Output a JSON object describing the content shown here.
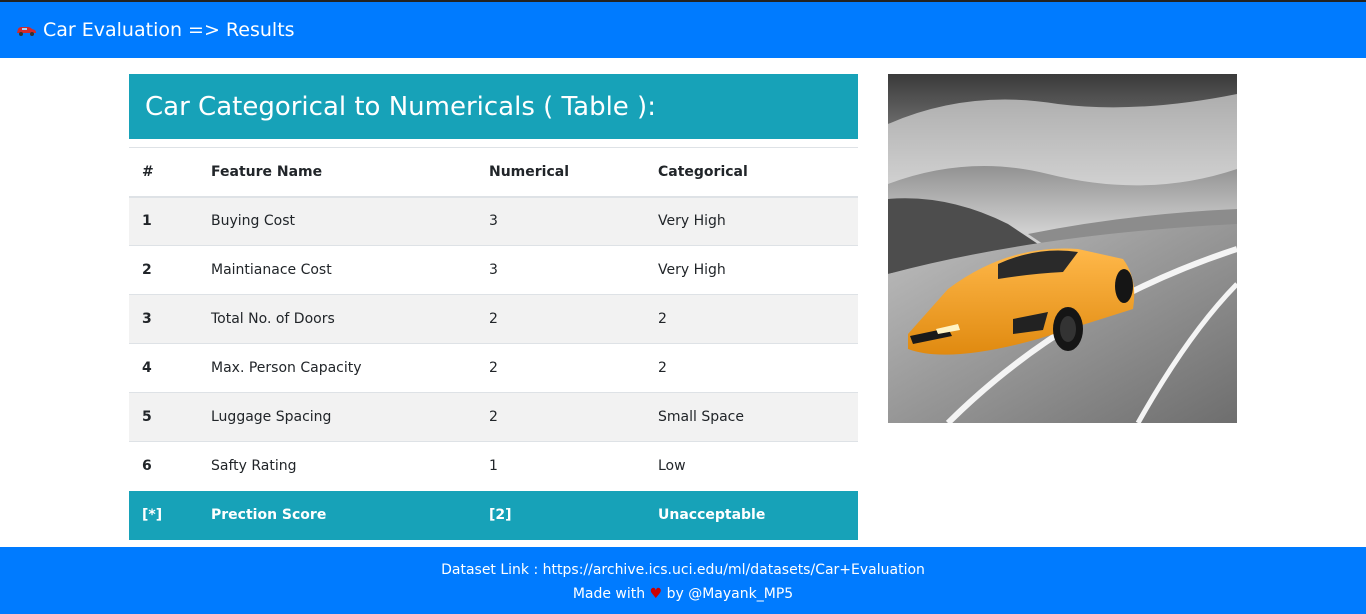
{
  "navbar": {
    "brand_icon": "car-icon",
    "brand_text": "Car Evaluation => Results"
  },
  "table_card": {
    "title": "Car Categorical to Numericals ( Table ):",
    "headers": [
      "#",
      "Feature Name",
      "Numerical",
      "Categorical"
    ],
    "rows": [
      {
        "num": "1",
        "feature": "Buying Cost",
        "numerical": "3",
        "categorical": "Very High"
      },
      {
        "num": "2",
        "feature": "Maintianace Cost",
        "numerical": "3",
        "categorical": "Very High"
      },
      {
        "num": "3",
        "feature": "Total No. of Doors",
        "numerical": "2",
        "categorical": "2"
      },
      {
        "num": "4",
        "feature": "Max. Person Capacity",
        "numerical": "2",
        "categorical": "2"
      },
      {
        "num": "5",
        "feature": "Luggage Spacing",
        "numerical": "2",
        "categorical": "Small Space"
      },
      {
        "num": "6",
        "feature": "Safty Rating",
        "numerical": "1",
        "categorical": "Low"
      }
    ],
    "result": {
      "num": "[*]",
      "feature": "Prection Score",
      "numerical": "[2]",
      "categorical": "Unacceptable"
    }
  },
  "image": {
    "subject": "orange sports car on road"
  },
  "footer": {
    "dataset_text": "Dataset Link : https://archive.ics.uci.edu/ml/datasets/Car+Evaluation",
    "made_with": "Made with",
    "heart_icon": "heart-icon",
    "by_text": "by @Mayank_MP5"
  },
  "colors": {
    "primary": "#007bff",
    "info": "#17a2b8",
    "stripe": "#f2f2f2",
    "heart": "#cc0000"
  }
}
